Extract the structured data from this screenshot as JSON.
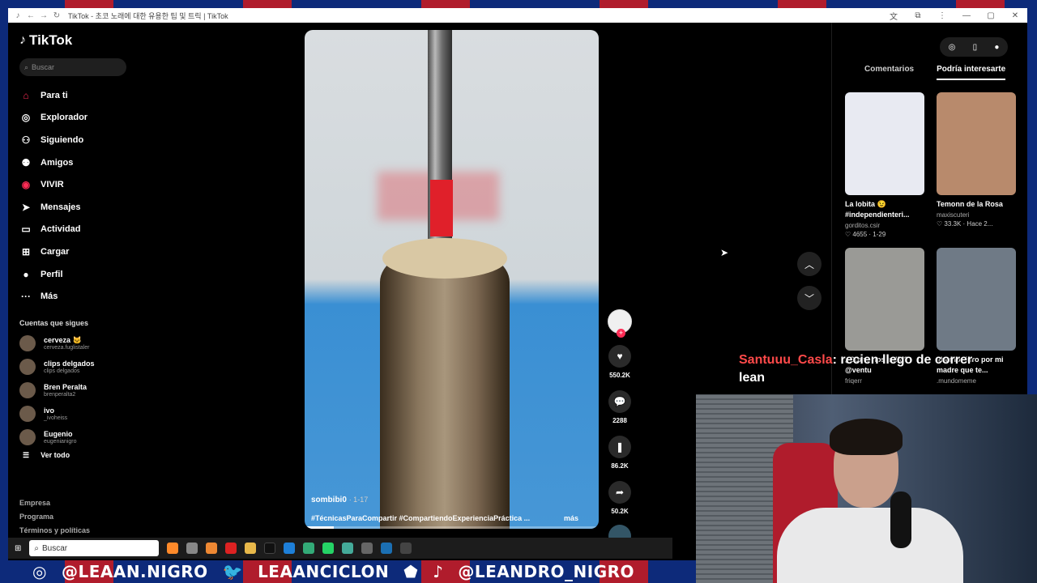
{
  "browser": {
    "tab_title": "TikTok - 초코 노래에 대한 유용한 팁 및 트릭 | TikTok"
  },
  "sidebar": {
    "logo": "TikTok",
    "search_placeholder": "Buscar",
    "items": [
      {
        "label": "Para ti",
        "icon": "home-icon"
      },
      {
        "label": "Explorador",
        "icon": "compass-icon"
      },
      {
        "label": "Siguiendo",
        "icon": "following-icon"
      },
      {
        "label": "Amigos",
        "icon": "friends-icon"
      },
      {
        "label": "VIVIR",
        "icon": "live-icon"
      },
      {
        "label": "Mensajes",
        "icon": "messages-icon"
      },
      {
        "label": "Actividad",
        "icon": "activity-icon"
      },
      {
        "label": "Cargar",
        "icon": "upload-icon"
      },
      {
        "label": "Perfil",
        "icon": "profile-icon"
      },
      {
        "label": "Más",
        "icon": "more-icon"
      }
    ],
    "following_title": "Cuentas que sigues",
    "following": [
      {
        "name": "cerveza 🐱",
        "handle": "cerveza.fuglistaler"
      },
      {
        "name": "clips delgados",
        "handle": "clips delgados"
      },
      {
        "name": "Bren Peralta",
        "handle": "brenperalta2"
      },
      {
        "name": "ivo",
        "handle": "_ivoheiss"
      },
      {
        "name": "Eugenio",
        "handle": "eugenianigro"
      }
    ],
    "see_all": "Ver todo",
    "footer": [
      "Empresa",
      "Programa",
      "Términos y políticas"
    ]
  },
  "video": {
    "author": "sombibi0",
    "date": "· 1-17",
    "description": "#TécnicasParaCompartir #CompartiendoExperienciaPráctica ...",
    "more": "más",
    "progress_fraction": 0.1
  },
  "actions": {
    "likes": "550.2K",
    "comments": "2288",
    "saves": "86.2K",
    "shares": "50.2K"
  },
  "right_panel": {
    "tabs": [
      "Comentarios",
      "Podría interesarte"
    ],
    "cards": [
      {
        "title": "La lobita 😉 #independienteri...",
        "author": "gorditos.csir",
        "stats": "♡ 4655 · 1-29",
        "color": "#e8eaf2"
      },
      {
        "title": "Temonn de la Rosa",
        "author": "maxiscuteri",
        "stats": "♡ 33.3K · Hace 2...",
        "color": "#b88a6c"
      },
      {
        "title": "¿Cómo nos salió? @ventu",
        "author": "friqerr",
        "stats": "",
        "color": "#9a9a96"
      },
      {
        "title": "#humor juro por mi madre que te...",
        "author": ".mundomeme",
        "stats": "",
        "color": "#6f7a86"
      }
    ]
  },
  "overlay": {
    "chat_user": "Santuuu_Casla",
    "chat_message": ": recien llego de correr",
    "chat_message2": "lean"
  },
  "taskbar": {
    "search": "Buscar"
  },
  "banner": {
    "instagram": "@LEAAN.NIGRO",
    "twitter": "LEAANCICLON",
    "tiktok": "@LEANDRO_NIGRO"
  }
}
